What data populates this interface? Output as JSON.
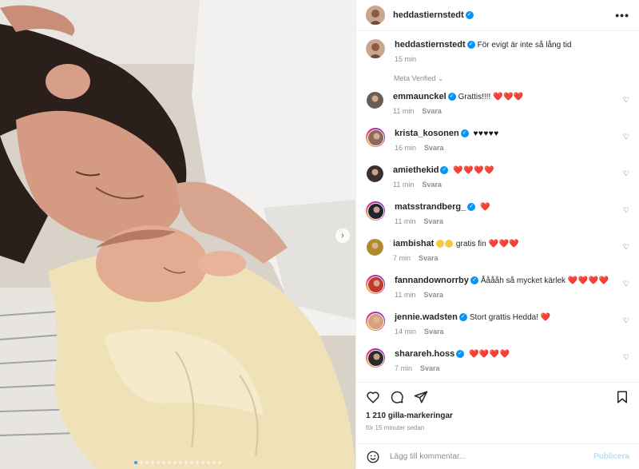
{
  "post": {
    "author": "heddastiernstedt",
    "caption": "För evigt är inte så lång tid",
    "caption_time": "15 min",
    "meta_verified": "Meta Verified",
    "likes": "1 210 gilla-markeringar",
    "posted": "för 15 minuter sedan",
    "carousel_dots": 16,
    "active_dot": 0
  },
  "comment_box": {
    "placeholder": "Lägg till kommentar...",
    "publish": "Publicera"
  },
  "reply_label": "Svara",
  "comments": [
    {
      "user": "emmaunckel",
      "verified": true,
      "text": "Grattis!!!!",
      "emoji": "❤️❤️❤️",
      "time": "11 min",
      "avatar": "#6b5d52",
      "story": false
    },
    {
      "user": "krista_kosonen",
      "verified": true,
      "text": "",
      "emoji": "♥♥♥♥♥",
      "time": "16 min",
      "avatar": "#8c6a5a",
      "story": true
    },
    {
      "user": "amiethekid",
      "verified": true,
      "text": "",
      "emoji": "❤️❤️❤️❤️",
      "time": "11 min",
      "avatar": "#3a2f2a",
      "story": false
    },
    {
      "user": "matsstrandberg_",
      "verified": true,
      "text": "",
      "emoji": "❤️",
      "time": "11 min",
      "avatar": "#1f2230",
      "story": true
    },
    {
      "user": "iambishat",
      "verified": false,
      "text": "gratis fin",
      "emoji": "❤️❤️❤️",
      "time": "7 min",
      "avatar": "#b08a2e",
      "story": false
    },
    {
      "user": "fannandownorrby",
      "verified": true,
      "text": "Ååååh så mycket kärlek",
      "emoji": "❤️❤️❤️❤️",
      "time": "11 min",
      "avatar": "#c0392b",
      "story": true
    },
    {
      "user": "jennie.wadsten",
      "verified": true,
      "text": "Stort grattis Hedda!",
      "emoji": "❤️",
      "time": "14 min",
      "avatar": "#d8a07a",
      "story": true
    },
    {
      "user": "sharareh.hoss",
      "verified": true,
      "text": "",
      "emoji": "❤️❤️❤️❤️",
      "time": "7 min",
      "avatar": "#2b2b2b",
      "story": true
    }
  ],
  "icons": {
    "more": "more-options-icon",
    "like": "heart-icon",
    "comment": "comment-icon",
    "share": "share-icon",
    "save": "bookmark-icon",
    "emoji": "emoji-icon",
    "next": "chevron-right-icon"
  },
  "colors": {
    "verified": "#0095f6",
    "heart_red": "#ed4956",
    "muted": "#8e8e8e",
    "publish": "#b2dffc",
    "carousel_active": "#3897f0"
  }
}
